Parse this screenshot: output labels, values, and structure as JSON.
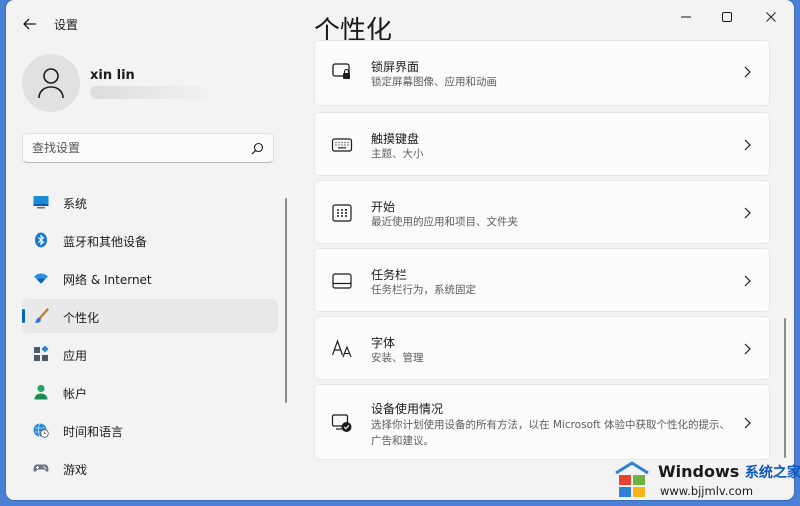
{
  "window": {
    "title": "设置",
    "page_title": "个性化"
  },
  "user": {
    "name": "xin lin"
  },
  "search": {
    "placeholder": "查找设置"
  },
  "sidebar": {
    "items": [
      {
        "label": "系统",
        "icon": "monitor-icon"
      },
      {
        "label": "蓝牙和其他设备",
        "icon": "bluetooth-icon"
      },
      {
        "label": "网络 & Internet",
        "icon": "wifi-icon"
      },
      {
        "label": "个性化",
        "icon": "brush-icon",
        "selected": true
      },
      {
        "label": "应用",
        "icon": "apps-icon"
      },
      {
        "label": "帐户",
        "icon": "account-icon"
      },
      {
        "label": "时间和语言",
        "icon": "globe-clock-icon"
      },
      {
        "label": "游戏",
        "icon": "gamepad-icon"
      }
    ]
  },
  "cards": [
    {
      "title": "锁屏界面",
      "subtitle": "锁定屏幕图像、应用和动画",
      "icon": "lock-screen-icon"
    },
    {
      "title": "触摸键盘",
      "subtitle": "主题、大小",
      "icon": "keyboard-icon"
    },
    {
      "title": "开始",
      "subtitle": "最近使用的应用和项目、文件夹",
      "icon": "start-icon"
    },
    {
      "title": "任务栏",
      "subtitle": "任务栏行为，系统固定",
      "icon": "taskbar-icon"
    },
    {
      "title": "字体",
      "subtitle": "安装、管理",
      "icon": "font-icon"
    },
    {
      "title": "设备使用情况",
      "subtitle": "选择你计划使用设备的所有方法，以在 Microsoft 体验中获取个性化的提示、广告和建议。",
      "icon": "device-usage-icon"
    }
  ],
  "watermark": {
    "brand": "Windows",
    "cn": "系统之家",
    "url": "www.bjjmlv.com"
  },
  "colors": {
    "accent": "#0067c0",
    "background": "#f3f3f3",
    "card": "#fbfbfb"
  }
}
